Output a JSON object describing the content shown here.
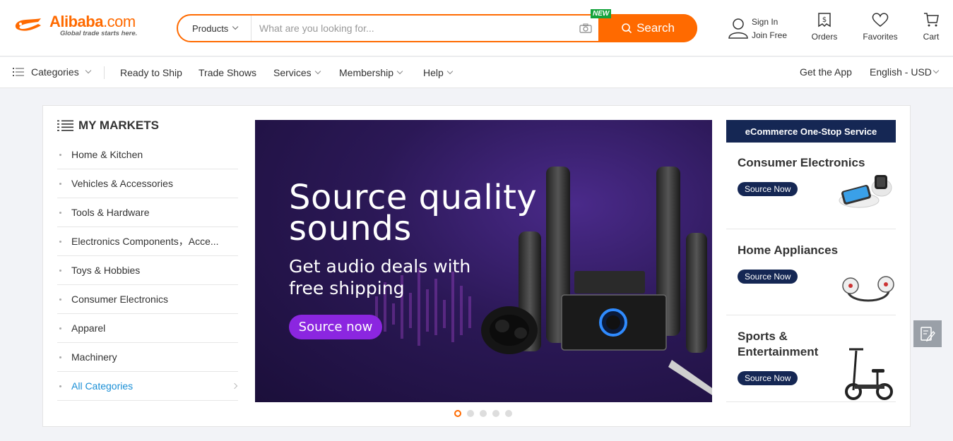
{
  "header": {
    "logo_text": "Alibaba",
    "logo_domain": ".com",
    "logo_tagline": "Global trade starts here.",
    "search_category": "Products",
    "search_placeholder": "What are you looking for...",
    "search_new_badge": "NEW",
    "search_button": "Search",
    "sign_in": "Sign In",
    "join_free": "Join Free",
    "orders": "Orders",
    "favorites": "Favorites",
    "cart": "Cart",
    "brand_color": "#ff6a00"
  },
  "nav": {
    "categories": "Categories",
    "ready_to_ship": "Ready to Ship",
    "trade_shows": "Trade Shows",
    "services": "Services",
    "membership": "Membership",
    "help": "Help",
    "get_app": "Get the App",
    "language_currency": "English - USD"
  },
  "markets": {
    "title": "MY MARKETS",
    "items": [
      "Home & Kitchen",
      "Vehicles & Accessories",
      "Tools & Hardware",
      "Electronics Components，Acce...",
      "Toys & Hobbies",
      "Consumer Electronics",
      "Apparel",
      "Machinery"
    ],
    "all_categories": "All Categories"
  },
  "banner": {
    "headline_line1": "Source quality",
    "headline_line2": "sounds",
    "sub_line1": "Get audio deals with",
    "sub_line2": "free shipping",
    "cta": "Source now",
    "slide_count": 5,
    "active_slide": 1
  },
  "ecommerce": {
    "header": "eCommerce One-Stop Service",
    "cards": [
      {
        "title": "Consumer Electronics",
        "cta": "Source Now"
      },
      {
        "title": "Home Appliances",
        "cta": "Source Now"
      },
      {
        "title_line1": "Sports &",
        "title_line2": "Entertainment",
        "cta": "Source Now"
      }
    ]
  }
}
